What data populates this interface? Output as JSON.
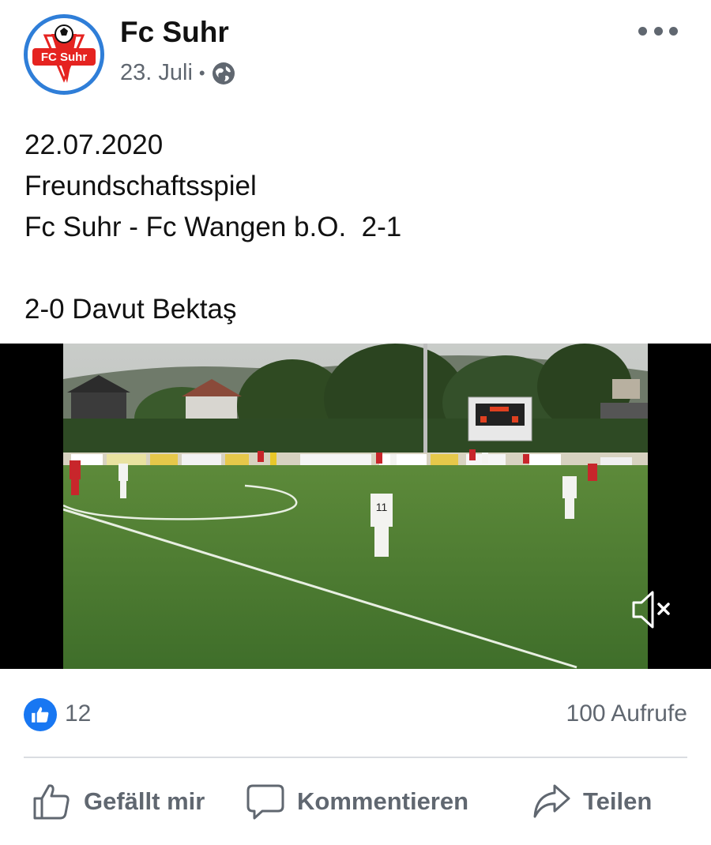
{
  "post": {
    "page_name": "Fc Suhr",
    "date": "23. Juli",
    "separator": "•",
    "privacy_icon": "globe-icon",
    "avatar_logo_text": "FC Suhr",
    "more_icon": "more-options-icon",
    "text_lines": [
      "22.07.2020",
      "Freundschaftsspiel",
      "Fc Suhr - Fc Wangen b.O.  2-1",
      "",
      "2-0 Davut Bektaş"
    ]
  },
  "video": {
    "mute_icon": "speaker-muted-icon",
    "state": "muted"
  },
  "stats": {
    "like_icon": "thumbs-up-icon",
    "like_count": "12",
    "views": "100 Aufrufe"
  },
  "actions": {
    "like_label": "Gefällt mir",
    "comment_label": "Kommentieren",
    "share_label": "Teilen"
  },
  "colors": {
    "accent": "#1877f2",
    "secondary_text": "#606770",
    "divider": "#dadde1",
    "logo_red": "#e52320",
    "logo_ring": "#2f7ed8"
  }
}
